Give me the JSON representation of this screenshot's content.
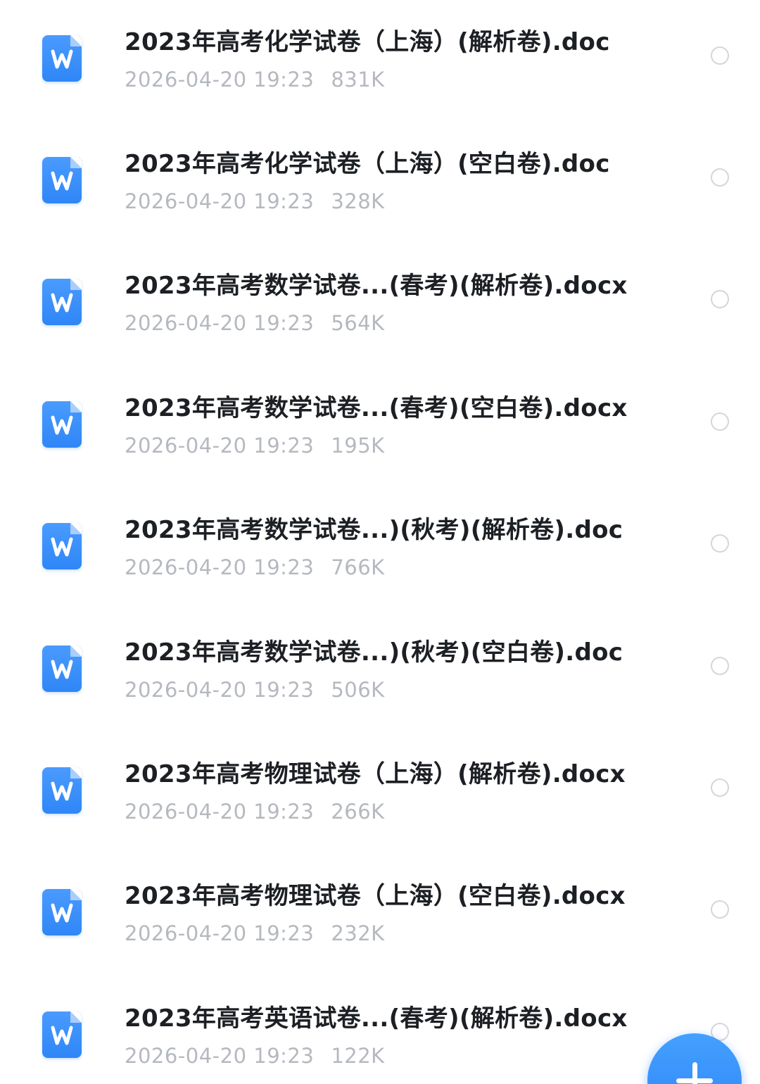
{
  "files": [
    {
      "name": "2023年高考化学试卷（上海）(解析卷).doc",
      "date": "2026-04-20 19:23",
      "size": "831K",
      "icon": "word-doc-icon",
      "selected": false
    },
    {
      "name": "2023年高考化学试卷（上海）(空白卷).doc",
      "date": "2026-04-20 19:23",
      "size": "328K",
      "icon": "word-doc-icon",
      "selected": false
    },
    {
      "name": "2023年高考数学试卷...(春考)(解析卷).docx",
      "date": "2026-04-20 19:23",
      "size": "564K",
      "icon": "word-doc-icon",
      "selected": false
    },
    {
      "name": "2023年高考数学试卷...(春考)(空白卷).docx",
      "date": "2026-04-20 19:23",
      "size": "195K",
      "icon": "word-doc-icon",
      "selected": false
    },
    {
      "name": "2023年高考数学试卷...)(秋考)(解析卷).doc",
      "date": "2026-04-20 19:23",
      "size": "766K",
      "icon": "word-doc-icon",
      "selected": false
    },
    {
      "name": "2023年高考数学试卷...)(秋考)(空白卷).doc",
      "date": "2026-04-20 19:23",
      "size": "506K",
      "icon": "word-doc-icon",
      "selected": false
    },
    {
      "name": "2023年高考物理试卷（上海）(解析卷).docx",
      "date": "2026-04-20 19:23",
      "size": "266K",
      "icon": "word-doc-icon",
      "selected": false
    },
    {
      "name": "2023年高考物理试卷（上海）(空白卷).docx",
      "date": "2026-04-20 19:23",
      "size": "232K",
      "icon": "word-doc-icon",
      "selected": false
    },
    {
      "name": "2023年高考英语试卷...(春考)(解析卷).docx",
      "date": "2026-04-20 19:23",
      "size": "122K",
      "icon": "word-doc-icon",
      "selected": false
    }
  ],
  "fab": {
    "icon": "plus-icon"
  },
  "colors": {
    "accent": "#2f86f6",
    "title_text": "#1c1f23",
    "meta_text": "#b5b9bf",
    "radio_border": "#d4d6da"
  }
}
